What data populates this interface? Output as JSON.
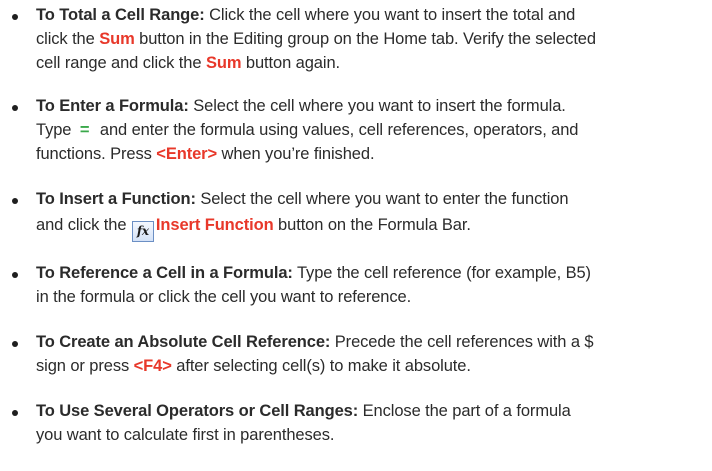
{
  "tips": [
    {
      "title": "To Total a Cell Range:",
      "line1": "Click the cell where you want to insert the total and",
      "line2a": "click the ",
      "sum1": "Sum",
      "line2b": " button in the Editing group on the Home tab. Verify the selected",
      "line3a": "cell range and click the ",
      "sum2": "Sum",
      "line3b": " button again."
    },
    {
      "title": "To Enter a Formula:",
      "line1": "Select the cell where you want to insert the formula.",
      "line2a": "Type ",
      "equals": "=",
      "line2b": " and enter the formula using values, cell references, operators, and",
      "line3a": "functions. Press ",
      "key": "<Enter>",
      "line3b": " when you’re finished."
    },
    {
      "title": "To Insert a Function:",
      "line1": "Select the cell where you want to enter the function",
      "line2a": "and click the ",
      "fx_icon": "fx",
      "button_label": "Insert Function",
      "line2b": " button on the Formula Bar."
    },
    {
      "title": "To Reference a Cell in a Formula:",
      "line1": "Type the cell reference (for example, B5)",
      "line2": "in the formula or click the cell you want to reference."
    },
    {
      "title": "To Create an Absolute Cell Reference:",
      "line1": "Precede the cell references with a $",
      "line2a": "sign or press ",
      "key": "<F4>",
      "line2b": " after selecting cell(s) to make it absolute."
    },
    {
      "title": "To Use Several Operators or Cell Ranges:",
      "line1": "Enclose the part of a formula",
      "line2": "you want to calculate first in parentheses."
    }
  ],
  "colors": {
    "accent": "#e8382a",
    "equals": "#3aa84a",
    "text": "#2b2b2b"
  }
}
